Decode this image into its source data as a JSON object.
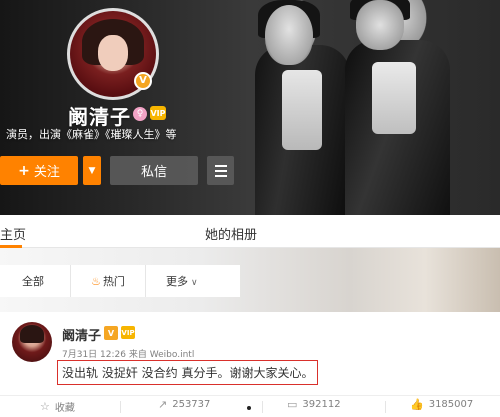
{
  "profile": {
    "name": "阚清子",
    "bio": "演员，出演《麻雀》《璀璨人生》等",
    "follow_label": "关注",
    "message_label": "私信",
    "verified_badge": "V",
    "vip_badge": "VIP"
  },
  "tabs": {
    "home": "主页",
    "album": "她的相册"
  },
  "filters": {
    "all": "全部",
    "hot": "热门",
    "more": "更多"
  },
  "post": {
    "author": "阚清子",
    "time": "7月31日 12:26",
    "source_prefix": "来自",
    "source": "Weibo.intl",
    "text": "没出轨 没捉奸 没合约 真分手。谢谢大家关心。"
  },
  "actions": {
    "favorite": "收藏",
    "share_count": "253737",
    "comment_count": "392112",
    "like_count": "3185007"
  },
  "colors": {
    "accent": "#ff8200",
    "highlight_border": "#d9302b"
  }
}
